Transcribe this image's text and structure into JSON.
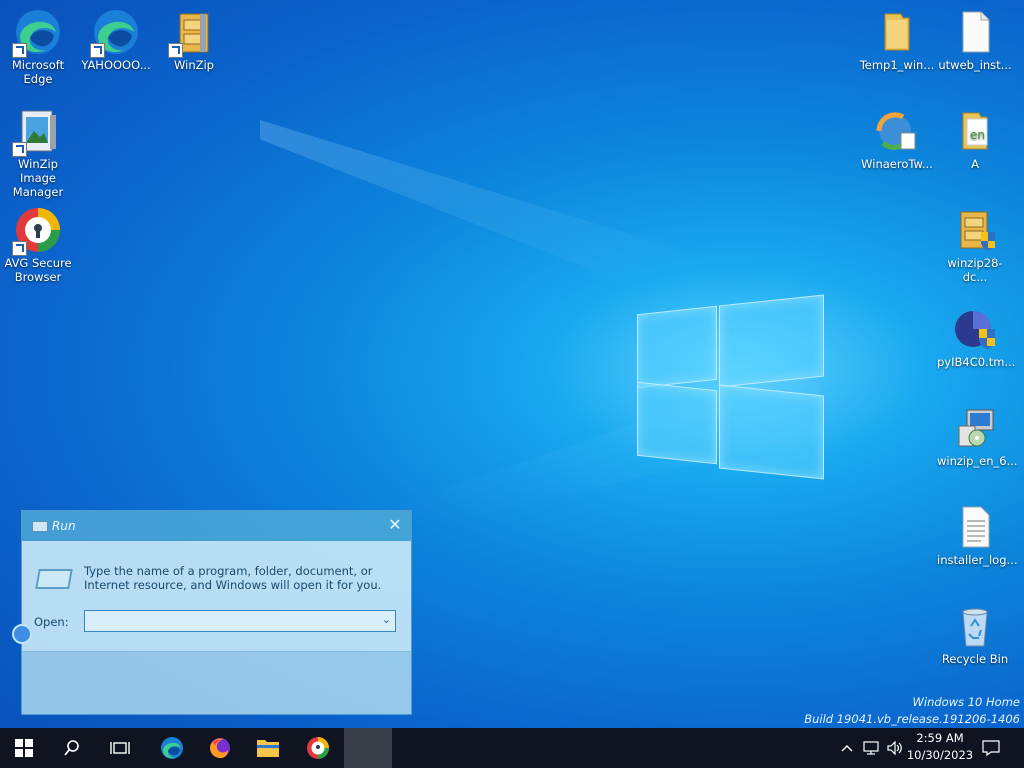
{
  "desktop": {
    "left_icons": [
      {
        "label": "Microsoft Edge",
        "icon": "edge-icon"
      },
      {
        "label": "YAHOOOO...",
        "icon": "edge-icon"
      },
      {
        "label": "WinZip",
        "icon": "winzip-icon"
      },
      {
        "label": "WinZip Image Manager",
        "icon": "winzip-image-manager-icon"
      },
      {
        "label": "AVG Secure Browser",
        "icon": "avg-secure-browser-icon"
      }
    ],
    "right_icons": [
      {
        "label": "Temp1_win...",
        "icon": "folder-icon"
      },
      {
        "label": "utweb_inst...",
        "icon": "file-icon"
      },
      {
        "label": "WinaeroTw...",
        "icon": "winaero-tweaker-icon"
      },
      {
        "label": "A",
        "icon": "folder-icon"
      },
      {
        "label": "winzip28-dc...",
        "icon": "installer-shield-icon"
      },
      {
        "label": "pyIB4C0.tm...",
        "icon": "installer-shield-icon"
      },
      {
        "label": "winzip_en_6...",
        "icon": "setup-installer-icon"
      },
      {
        "label": "installer_log...",
        "icon": "text-file-icon"
      },
      {
        "label": "Recycle Bin",
        "icon": "recycle-bin-icon"
      }
    ]
  },
  "run_dialog": {
    "title": "Run",
    "close_glyph": "✕",
    "description": "Type the name of a program, folder, document, or Internet resource, and Windows will open it for you.",
    "open_label": "Open:",
    "open_value": ""
  },
  "watermark": {
    "edition": "Windows 10 Home",
    "build": "Build 19041.vb_release.191206-1406"
  },
  "taskbar": {
    "items": [
      {
        "name": "start-button",
        "icon": "windows-logo-icon"
      },
      {
        "name": "search-button",
        "icon": "search-icon"
      },
      {
        "name": "task-view-button",
        "icon": "task-view-icon"
      },
      {
        "name": "edge-taskbar-button",
        "icon": "edge-icon"
      },
      {
        "name": "firefox-taskbar-button",
        "icon": "firefox-icon"
      },
      {
        "name": "file-explorer-taskbar-button",
        "icon": "folder-icon"
      },
      {
        "name": "avg-browser-taskbar-button",
        "icon": "avg-secure-browser-icon"
      },
      {
        "name": "run-taskbar-button",
        "icon": "run-icon"
      }
    ],
    "clock": {
      "time": "2:59 AM",
      "date": "10/30/2023"
    }
  },
  "colors": {
    "accent": "#0b63cc",
    "taskbar": "#0f1420"
  }
}
